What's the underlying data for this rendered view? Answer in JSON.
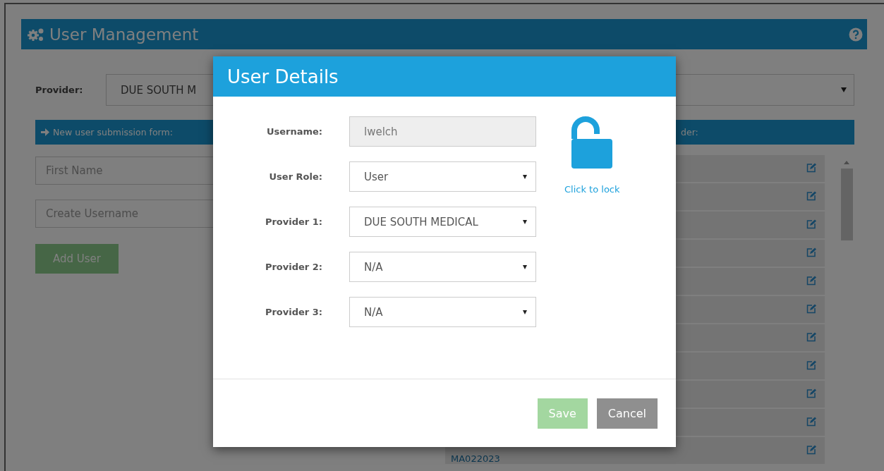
{
  "page": {
    "title": "User Management",
    "provider_label": "Provider:",
    "provider_value": "DUE SOUTH M",
    "form_section": "New user submission form:",
    "form_fields": [
      {
        "placeholder": "First Name"
      },
      {
        "placeholder": "Create Username"
      }
    ],
    "add_button": {
      "label": "Add User",
      "disabled": true
    },
    "list_section": "der:",
    "rows": [
      {
        "kind": "user"
      },
      {
        "kind": "user"
      },
      {
        "kind": "user"
      },
      {
        "kind": "user"
      },
      {
        "kind": "user"
      },
      {
        "kind": "user"
      },
      {
        "kind": "user"
      },
      {
        "kind": "user"
      },
      {
        "kind": "user"
      },
      {
        "kind": "user"
      },
      {
        "kind": "user",
        "label": "MA022023"
      }
    ]
  },
  "dialog": {
    "title": "User Details",
    "fields": [
      {
        "label": "Username:",
        "kind": "text",
        "value": "lwelch",
        "disabled": true
      },
      {
        "label": "User Role:",
        "kind": "select",
        "value": "User",
        "disabled": false
      },
      {
        "label": "Provider 1:",
        "kind": "select",
        "value": "DUE SOUTH MEDICAL",
        "disabled": false
      },
      {
        "label": "Provider 2:",
        "kind": "select",
        "value": "N/A",
        "disabled": false
      },
      {
        "label": "Provider 3:",
        "kind": "select",
        "value": "N/A",
        "disabled": false
      }
    ],
    "lock": {
      "locked": false,
      "caption": "Click to lock"
    },
    "buttons": [
      {
        "label": "Save",
        "kind": "primary",
        "disabled": true
      },
      {
        "label": "Cancel",
        "kind": "secondary",
        "disabled": false
      }
    ]
  }
}
